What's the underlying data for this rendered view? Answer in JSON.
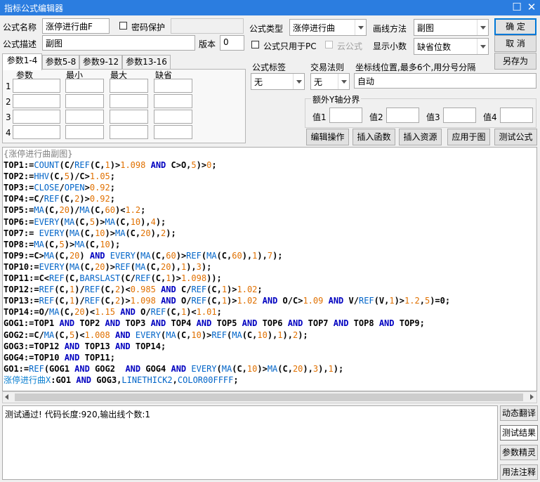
{
  "window": {
    "title": "指标公式编辑器",
    "minimize_icon": "☐",
    "close_icon": "✕"
  },
  "form": {
    "name_label": "公式名称",
    "name_value": "涨停进行曲F",
    "password_label": "密码保护",
    "desc_label": "公式描述",
    "desc_value": "副图",
    "version_label": "版本",
    "version_value": "0",
    "type_label": "公式类型",
    "type_value": "涨停进行曲",
    "draw_label": "画线方法",
    "draw_value": "副图",
    "pc_only_label": "公式只用于PC",
    "cloud_label": "云公式",
    "decimals_label": "显示小数",
    "decimals_value": "缺省位数",
    "tag_label": "公式标签",
    "tag_value": "无",
    "rule_label": "交易法则",
    "rule_value": "无",
    "axis_label": "坐标线位置,最多6个,用分号分隔",
    "axis_value": "自动",
    "yaxis_group_label": "额外Y轴分界",
    "yaxis_values": [
      "值1",
      "值2",
      "值3",
      "值4"
    ]
  },
  "buttons": {
    "ok": "确  定",
    "cancel": "取  消",
    "save_as": "另存为",
    "edit_ops": "编辑操作",
    "insert_func": "插入函数",
    "insert_res": "插入资源",
    "apply": "应用于图",
    "test": "测试公式"
  },
  "params": {
    "tabs": [
      "参数1-4",
      "参数5-8",
      "参数9-12",
      "参数13-16"
    ],
    "headers": [
      "参数",
      "最小",
      "最大",
      "缺省"
    ],
    "rows": [
      "1",
      "2",
      "3",
      "4"
    ]
  },
  "code_lines": [
    [
      [
        "cm",
        "{涨停进行曲副图}"
      ]
    ],
    [
      [
        "kw",
        "TOP1:="
      ],
      [
        "fn",
        "COUNT"
      ],
      [
        "kw",
        "(C/"
      ],
      [
        "fn",
        "REF"
      ],
      [
        "kw",
        "(C,"
      ],
      [
        "num",
        "1"
      ],
      [
        "kw",
        ")>"
      ],
      [
        "num",
        "1.098"
      ],
      [
        "kw",
        " "
      ],
      [
        "bl",
        "AND"
      ],
      [
        "kw",
        " C>O,"
      ],
      [
        "num",
        "5"
      ],
      [
        "kw",
        ")>"
      ],
      [
        "num",
        "0"
      ],
      [
        "kw",
        ";"
      ]
    ],
    [
      [
        "kw",
        "TOP2:="
      ],
      [
        "fn",
        "HHV"
      ],
      [
        "kw",
        "(C,"
      ],
      [
        "num",
        "5"
      ],
      [
        "kw",
        ")/C>"
      ],
      [
        "num",
        "1.05"
      ],
      [
        "kw",
        ";"
      ]
    ],
    [
      [
        "kw",
        "TOP3:="
      ],
      [
        "fn",
        "CLOSE"
      ],
      [
        "kw",
        "/"
      ],
      [
        "fn",
        "OPEN"
      ],
      [
        "kw",
        ">"
      ],
      [
        "num",
        "0.92"
      ],
      [
        "kw",
        ";"
      ]
    ],
    [
      [
        "kw",
        "TOP4:=C/"
      ],
      [
        "fn",
        "REF"
      ],
      [
        "kw",
        "(C,"
      ],
      [
        "num",
        "2"
      ],
      [
        "kw",
        ")>"
      ],
      [
        "num",
        "0.92"
      ],
      [
        "kw",
        ";"
      ]
    ],
    [
      [
        "kw",
        "TOP5:="
      ],
      [
        "fn",
        "MA"
      ],
      [
        "kw",
        "(C,"
      ],
      [
        "num",
        "20"
      ],
      [
        "kw",
        ")/"
      ],
      [
        "fn",
        "MA"
      ],
      [
        "kw",
        "(C,"
      ],
      [
        "num",
        "60"
      ],
      [
        "kw",
        ")<"
      ],
      [
        "num",
        "1.2"
      ],
      [
        "kw",
        ";"
      ]
    ],
    [
      [
        "kw",
        "TOP6:="
      ],
      [
        "fn",
        "EVERY"
      ],
      [
        "kw",
        "("
      ],
      [
        "fn",
        "MA"
      ],
      [
        "kw",
        "(C,"
      ],
      [
        "num",
        "5"
      ],
      [
        "kw",
        ")>"
      ],
      [
        "fn",
        "MA"
      ],
      [
        "kw",
        "(C,"
      ],
      [
        "num",
        "10"
      ],
      [
        "kw",
        "),"
      ],
      [
        "num",
        "4"
      ],
      [
        "kw",
        ");"
      ]
    ],
    [
      [
        "kw",
        "TOP7:= "
      ],
      [
        "fn",
        "EVERY"
      ],
      [
        "kw",
        "("
      ],
      [
        "fn",
        "MA"
      ],
      [
        "kw",
        "(C,"
      ],
      [
        "num",
        "10"
      ],
      [
        "kw",
        ")>"
      ],
      [
        "fn",
        "MA"
      ],
      [
        "kw",
        "(C,"
      ],
      [
        "num",
        "20"
      ],
      [
        "kw",
        "),"
      ],
      [
        "num",
        "2"
      ],
      [
        "kw",
        ");"
      ]
    ],
    [
      [
        "kw",
        "TOP8:="
      ],
      [
        "fn",
        "MA"
      ],
      [
        "kw",
        "(C,"
      ],
      [
        "num",
        "5"
      ],
      [
        "kw",
        ")>"
      ],
      [
        "fn",
        "MA"
      ],
      [
        "kw",
        "(C,"
      ],
      [
        "num",
        "10"
      ],
      [
        "kw",
        ");"
      ]
    ],
    [
      [
        "kw",
        "TOP9:=C>"
      ],
      [
        "fn",
        "MA"
      ],
      [
        "kw",
        "(C,"
      ],
      [
        "num",
        "20"
      ],
      [
        "kw",
        ") "
      ],
      [
        "bl",
        "AND"
      ],
      [
        "kw",
        " "
      ],
      [
        "fn",
        "EVERY"
      ],
      [
        "kw",
        "("
      ],
      [
        "fn",
        "MA"
      ],
      [
        "kw",
        "(C,"
      ],
      [
        "num",
        "60"
      ],
      [
        "kw",
        ")>"
      ],
      [
        "fn",
        "REF"
      ],
      [
        "kw",
        "("
      ],
      [
        "fn",
        "MA"
      ],
      [
        "kw",
        "(C,"
      ],
      [
        "num",
        "60"
      ],
      [
        "kw",
        "),"
      ],
      [
        "num",
        "1"
      ],
      [
        "kw",
        "),"
      ],
      [
        "num",
        "7"
      ],
      [
        "kw",
        ");"
      ]
    ],
    [
      [
        "kw",
        "TOP10:="
      ],
      [
        "fn",
        "EVERY"
      ],
      [
        "kw",
        "("
      ],
      [
        "fn",
        "MA"
      ],
      [
        "kw",
        "(C,"
      ],
      [
        "num",
        "20"
      ],
      [
        "kw",
        ")>"
      ],
      [
        "fn",
        "REF"
      ],
      [
        "kw",
        "("
      ],
      [
        "fn",
        "MA"
      ],
      [
        "kw",
        "(C,"
      ],
      [
        "num",
        "20"
      ],
      [
        "kw",
        "),"
      ],
      [
        "num",
        "1"
      ],
      [
        "kw",
        "),"
      ],
      [
        "num",
        "3"
      ],
      [
        "kw",
        ");"
      ]
    ],
    [
      [
        "kw",
        "TOP11:=C<"
      ],
      [
        "fn",
        "REF"
      ],
      [
        "kw",
        "(C,"
      ],
      [
        "fn",
        "BARSLAST"
      ],
      [
        "kw",
        "(C/"
      ],
      [
        "fn",
        "REF"
      ],
      [
        "kw",
        "(C,"
      ],
      [
        "num",
        "1"
      ],
      [
        "kw",
        ")>"
      ],
      [
        "num",
        "1.098"
      ],
      [
        "kw",
        "));"
      ]
    ],
    [
      [
        "kw",
        "TOP12:="
      ],
      [
        "fn",
        "REF"
      ],
      [
        "kw",
        "(C,"
      ],
      [
        "num",
        "1"
      ],
      [
        "kw",
        ")/"
      ],
      [
        "fn",
        "REF"
      ],
      [
        "kw",
        "(C,"
      ],
      [
        "num",
        "2"
      ],
      [
        "kw",
        ")<"
      ],
      [
        "num",
        "0.985"
      ],
      [
        "kw",
        " "
      ],
      [
        "bl",
        "AND"
      ],
      [
        "kw",
        " C/"
      ],
      [
        "fn",
        "REF"
      ],
      [
        "kw",
        "(C,"
      ],
      [
        "num",
        "1"
      ],
      [
        "kw",
        ")>"
      ],
      [
        "num",
        "1.02"
      ],
      [
        "kw",
        ";"
      ]
    ],
    [
      [
        "kw",
        "TOP13:="
      ],
      [
        "fn",
        "REF"
      ],
      [
        "kw",
        "(C,"
      ],
      [
        "num",
        "1"
      ],
      [
        "kw",
        ")/"
      ],
      [
        "fn",
        "REF"
      ],
      [
        "kw",
        "(C,"
      ],
      [
        "num",
        "2"
      ],
      [
        "kw",
        ")>"
      ],
      [
        "num",
        "1.098"
      ],
      [
        "kw",
        " "
      ],
      [
        "bl",
        "AND"
      ],
      [
        "kw",
        " O/"
      ],
      [
        "fn",
        "REF"
      ],
      [
        "kw",
        "(C,"
      ],
      [
        "num",
        "1"
      ],
      [
        "kw",
        ")>"
      ],
      [
        "num",
        "1.02"
      ],
      [
        "kw",
        " "
      ],
      [
        "bl",
        "AND"
      ],
      [
        "kw",
        " O/C>"
      ],
      [
        "num",
        "1.09"
      ],
      [
        "kw",
        " "
      ],
      [
        "bl",
        "AND"
      ],
      [
        "kw",
        " V/"
      ],
      [
        "fn",
        "REF"
      ],
      [
        "kw",
        "(V,"
      ],
      [
        "num",
        "1"
      ],
      [
        "kw",
        ")>"
      ],
      [
        "num",
        "1.2"
      ],
      [
        "kw",
        ","
      ],
      [
        "num",
        "5"
      ],
      [
        "kw",
        ")=0;"
      ]
    ],
    [
      [
        "kw",
        "TOP14:=O/"
      ],
      [
        "fn",
        "MA"
      ],
      [
        "kw",
        "(C,"
      ],
      [
        "num",
        "20"
      ],
      [
        "kw",
        ")<"
      ],
      [
        "num",
        "1.15"
      ],
      [
        "kw",
        " "
      ],
      [
        "bl",
        "AND"
      ],
      [
        "kw",
        " O/"
      ],
      [
        "fn",
        "REF"
      ],
      [
        "kw",
        "(C,"
      ],
      [
        "num",
        "1"
      ],
      [
        "kw",
        ")<"
      ],
      [
        "num",
        "1.01"
      ],
      [
        "kw",
        ";"
      ]
    ],
    [
      [
        "kw",
        "GOG1:=TOP1 "
      ],
      [
        "bl",
        "AND"
      ],
      [
        "kw",
        " TOP2 "
      ],
      [
        "bl",
        "AND"
      ],
      [
        "kw",
        " TOP3 "
      ],
      [
        "bl",
        "AND"
      ],
      [
        "kw",
        " TOP4 "
      ],
      [
        "bl",
        "AND"
      ],
      [
        "kw",
        " TOP5 "
      ],
      [
        "bl",
        "AND"
      ],
      [
        "kw",
        " TOP6 "
      ],
      [
        "bl",
        "AND"
      ],
      [
        "kw",
        " TOP7 "
      ],
      [
        "bl",
        "AND"
      ],
      [
        "kw",
        " TOP8 "
      ],
      [
        "bl",
        "AND"
      ],
      [
        "kw",
        " TOP9;"
      ]
    ],
    [
      [
        "kw",
        "GOG2:=C/"
      ],
      [
        "fn",
        "MA"
      ],
      [
        "kw",
        "(C,"
      ],
      [
        "num",
        "5"
      ],
      [
        "kw",
        ")<"
      ],
      [
        "num",
        "1.008"
      ],
      [
        "kw",
        " "
      ],
      [
        "bl",
        "AND"
      ],
      [
        "kw",
        " "
      ],
      [
        "fn",
        "EVERY"
      ],
      [
        "kw",
        "("
      ],
      [
        "fn",
        "MA"
      ],
      [
        "kw",
        "(C,"
      ],
      [
        "num",
        "10"
      ],
      [
        "kw",
        ")>"
      ],
      [
        "fn",
        "REF"
      ],
      [
        "kw",
        "("
      ],
      [
        "fn",
        "MA"
      ],
      [
        "kw",
        "(C,"
      ],
      [
        "num",
        "10"
      ],
      [
        "kw",
        "),"
      ],
      [
        "num",
        "1"
      ],
      [
        "kw",
        "),"
      ],
      [
        "num",
        "2"
      ],
      [
        "kw",
        ");"
      ]
    ],
    [
      [
        "kw",
        "GOG3:=TOP12 "
      ],
      [
        "bl",
        "AND"
      ],
      [
        "kw",
        " TOP13 "
      ],
      [
        "bl",
        "AND"
      ],
      [
        "kw",
        " TOP14;"
      ]
    ],
    [
      [
        "kw",
        "GOG4:=TOP10 "
      ],
      [
        "bl",
        "AND"
      ],
      [
        "kw",
        " TOP11;"
      ]
    ],
    [
      [
        "kw",
        "GO1:="
      ],
      [
        "fn",
        "REF"
      ],
      [
        "kw",
        "(GOG1 "
      ],
      [
        "bl",
        "AND"
      ],
      [
        "kw",
        " GOG2  "
      ],
      [
        "bl",
        "AND"
      ],
      [
        "kw",
        " GOG4 "
      ],
      [
        "bl",
        "AND"
      ],
      [
        "kw",
        " "
      ],
      [
        "fn",
        "EVERY"
      ],
      [
        "kw",
        "("
      ],
      [
        "fn",
        "MA"
      ],
      [
        "kw",
        "(C,"
      ],
      [
        "num",
        "10"
      ],
      [
        "kw",
        ")>"
      ],
      [
        "fn",
        "MA"
      ],
      [
        "kw",
        "(C,"
      ],
      [
        "num",
        "20"
      ],
      [
        "kw",
        "),"
      ],
      [
        "num",
        "3"
      ],
      [
        "kw",
        "),"
      ],
      [
        "num",
        "1"
      ],
      [
        "kw",
        ");"
      ]
    ],
    [
      [
        "cy",
        "涨停进行曲X"
      ],
      [
        "kw",
        ":GO1 "
      ],
      [
        "bl",
        "AND"
      ],
      [
        "kw",
        " GOG3,"
      ],
      [
        "fn",
        "LINETHICK2"
      ],
      [
        "kw",
        ","
      ],
      [
        "fn",
        "COLOR00FFFF"
      ],
      [
        "kw",
        ";"
      ]
    ]
  ],
  "output": {
    "message": "测试通过! 代码长度:920,输出线个数:1"
  },
  "side_buttons": [
    "动态翻译",
    "测试结果",
    "参数精灵",
    "用法注释"
  ]
}
